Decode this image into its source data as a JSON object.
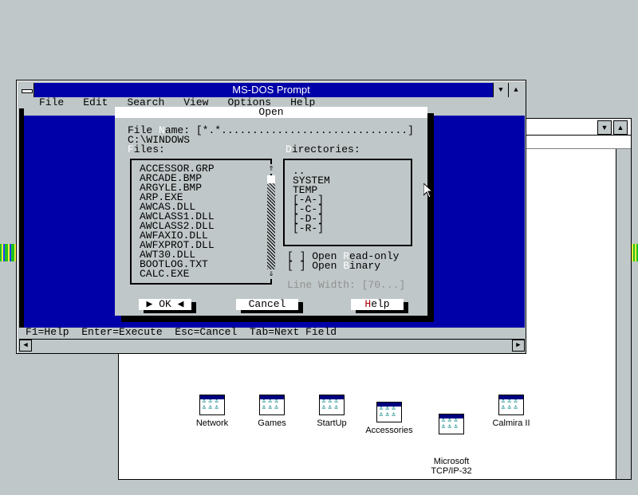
{
  "dos": {
    "title": "MS-DOS Prompt",
    "menu": [
      "File",
      "Edit",
      "Search",
      "View",
      "Options",
      "Help"
    ],
    "status": "F1=Help  Enter=Execute  Esc=Cancel  Tab=Next Field"
  },
  "dialog": {
    "title": "Open",
    "filename_label_pre": "File ",
    "filename_label_hot": "N",
    "filename_label_post": "ame: ",
    "filename_value": "[*.*..............................]",
    "current_dir": "C:\\WINDOWS",
    "files_label_hot": "F",
    "files_label_post": "iles:",
    "dirs_label_hot": "D",
    "dirs_label_post": "irectories:",
    "files": [
      "ACCESSOR.GRP",
      "ARCADE.BMP",
      "ARGYLE.BMP",
      "ARP.EXE",
      "AWCAS.DLL",
      "AWCLASS1.DLL",
      "AWCLASS2.DLL",
      "AWFAXIO.DLL",
      "AWFXPROT.DLL",
      "AWT30.DLL",
      "BOOTLOG.TXT",
      "CALC.EXE"
    ],
    "directories": [
      "..",
      "SYSTEM",
      "TEMP",
      "[-A-]",
      "[-C-]",
      "[-D-]",
      "[-R-]"
    ],
    "readonly_pre": "[ ] Open ",
    "readonly_hot": "R",
    "readonly_post": "ead-only",
    "binary_pre": "[ ] Open ",
    "binary_hot": "B",
    "binary_post": "inary",
    "line_width": "Line Width: [70...]",
    "ok_label": "OK",
    "cancel_label": "Cancel",
    "help_hot": "H",
    "help_post": "elp"
  },
  "group_icons": [
    {
      "label": "Network"
    },
    {
      "label": "Games"
    },
    {
      "label": "StartUp"
    },
    {
      "label": "Accessories"
    },
    {
      "label": "Microsoft\nTCP/IP-32"
    },
    {
      "label": "Calmira II"
    }
  ]
}
